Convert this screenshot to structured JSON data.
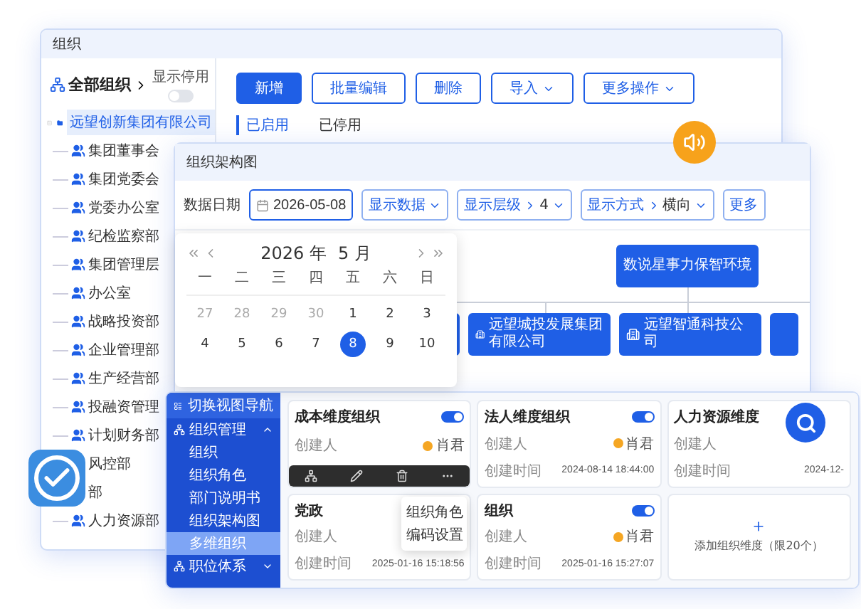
{
  "back_window": {
    "title": "组织",
    "tree_header": "全部组织",
    "show_disabled": {
      "label": "显示停用",
      "on": false
    },
    "tree": [
      {
        "label": "远望创新集团有限公司",
        "selected": true,
        "expanded": true,
        "children": [
          {
            "label": "集团董事会",
            "selected": false
          },
          {
            "label": "集团党委会",
            "selected": false
          },
          {
            "label": "党委办公室",
            "selected": false
          },
          {
            "label": "纪检监察部",
            "selected": false
          },
          {
            "label": "集团管理层",
            "selected": false
          },
          {
            "label": "办公室",
            "selected": false
          },
          {
            "label": "战略投资部",
            "selected": false
          },
          {
            "label": "企业管理部",
            "selected": false
          },
          {
            "label": "生产经营部",
            "selected": false
          },
          {
            "label": "投融资管理",
            "selected": false
          },
          {
            "label": "计划财务部",
            "selected": false
          },
          {
            "label": "风控部",
            "selected": false
          },
          {
            "label": "部",
            "selected": false
          },
          {
            "label": "人力资源部",
            "selected": false
          }
        ]
      }
    ],
    "buttons": [
      {
        "label": "新增",
        "kind": "primary"
      },
      {
        "label": "批量编辑",
        "kind": "outline"
      },
      {
        "label": "删除",
        "kind": "outline"
      },
      {
        "label": "导入",
        "kind": "dropdown"
      },
      {
        "label": "更多操作",
        "kind": "dropdown"
      }
    ],
    "tabs": [
      {
        "label": "已启用",
        "selected": true
      },
      {
        "label": "已停用",
        "selected": false
      }
    ]
  },
  "chart_window": {
    "title": "组织架构图",
    "date_label": "数据日期",
    "date_value": "2026-05-08",
    "filters": [
      {
        "kind": "dropdown",
        "label": "显示数据"
      },
      {
        "kind": "select",
        "label": "显示层级",
        "value": "4"
      },
      {
        "kind": "select",
        "label": "显示方式",
        "value": "横向"
      },
      {
        "kind": "cut",
        "label": "更多"
      }
    ],
    "root_node": "数说星事力保智环境",
    "child_nodes": [
      "远望城投发展集团有限公司",
      "远望智通科技公司"
    ]
  },
  "calendar": {
    "year": "2026 年",
    "month": "5 月",
    "weekdays": [
      "一",
      "二",
      "三",
      "四",
      "五",
      "六",
      "日"
    ],
    "days": [
      {
        "label": "27",
        "kind": "other",
        "selected": false
      },
      {
        "label": "28",
        "kind": "other",
        "selected": false
      },
      {
        "label": "29",
        "kind": "other",
        "selected": false
      },
      {
        "label": "30",
        "kind": "other",
        "selected": false
      },
      {
        "label": "1",
        "kind": "current",
        "selected": false
      },
      {
        "label": "2",
        "kind": "current",
        "selected": false
      },
      {
        "label": "3",
        "kind": "current",
        "selected": false
      },
      {
        "label": "4",
        "kind": "current",
        "selected": false
      },
      {
        "label": "5",
        "kind": "current",
        "selected": false
      },
      {
        "label": "6",
        "kind": "current",
        "selected": false
      },
      {
        "label": "7",
        "kind": "current",
        "selected": false
      },
      {
        "label": "8",
        "kind": "current",
        "selected": true
      },
      {
        "label": "9",
        "kind": "current",
        "selected": false
      },
      {
        "label": "10",
        "kind": "current",
        "selected": false
      }
    ]
  },
  "dimension_window": {
    "nav_title": "切换视图导航",
    "menu": [
      {
        "label": "组织管理",
        "kind": "group",
        "expanded": true
      },
      {
        "label": "组织",
        "kind": "item",
        "selected": false
      },
      {
        "label": "组织角色",
        "kind": "item",
        "selected": false
      },
      {
        "label": "部门说明书",
        "kind": "item",
        "selected": false
      },
      {
        "label": "组织架构图",
        "kind": "item",
        "selected": false
      },
      {
        "label": "多维组织",
        "kind": "item",
        "selected": true
      },
      {
        "label": "职位体系",
        "kind": "group",
        "expanded": false
      }
    ],
    "cards": [
      {
        "kind": "dimension",
        "title": "成本维度组织",
        "on": true,
        "creator_label": "创建人",
        "creator": "肖君",
        "toolbar": true
      },
      {
        "kind": "dimension",
        "title": "法人维度组织",
        "on": true,
        "creator_label": "创建人",
        "creator": "肖君",
        "time_label": "创建时间",
        "time": "2024-08-14 18:44:00"
      },
      {
        "kind": "dimension",
        "title": "人力资源维度",
        "creator_label": "创建人",
        "time_label": "创建时间",
        "time": "2024-12-"
      },
      {
        "kind": "dimension",
        "title": "党政",
        "creator_label": "创建人",
        "time_label": "创建时间",
        "time": "2025-01-16 15:18:56"
      },
      {
        "kind": "dimension",
        "title": "组织",
        "on": true,
        "creator_label": "创建人",
        "creator": "肖君",
        "time_label": "创建时间",
        "time": "2025-01-16 15:27:07"
      },
      {
        "kind": "add",
        "label": "添加组织维度（限20个）"
      }
    ],
    "context_menu": [
      "组织角色",
      "编码设置"
    ]
  }
}
